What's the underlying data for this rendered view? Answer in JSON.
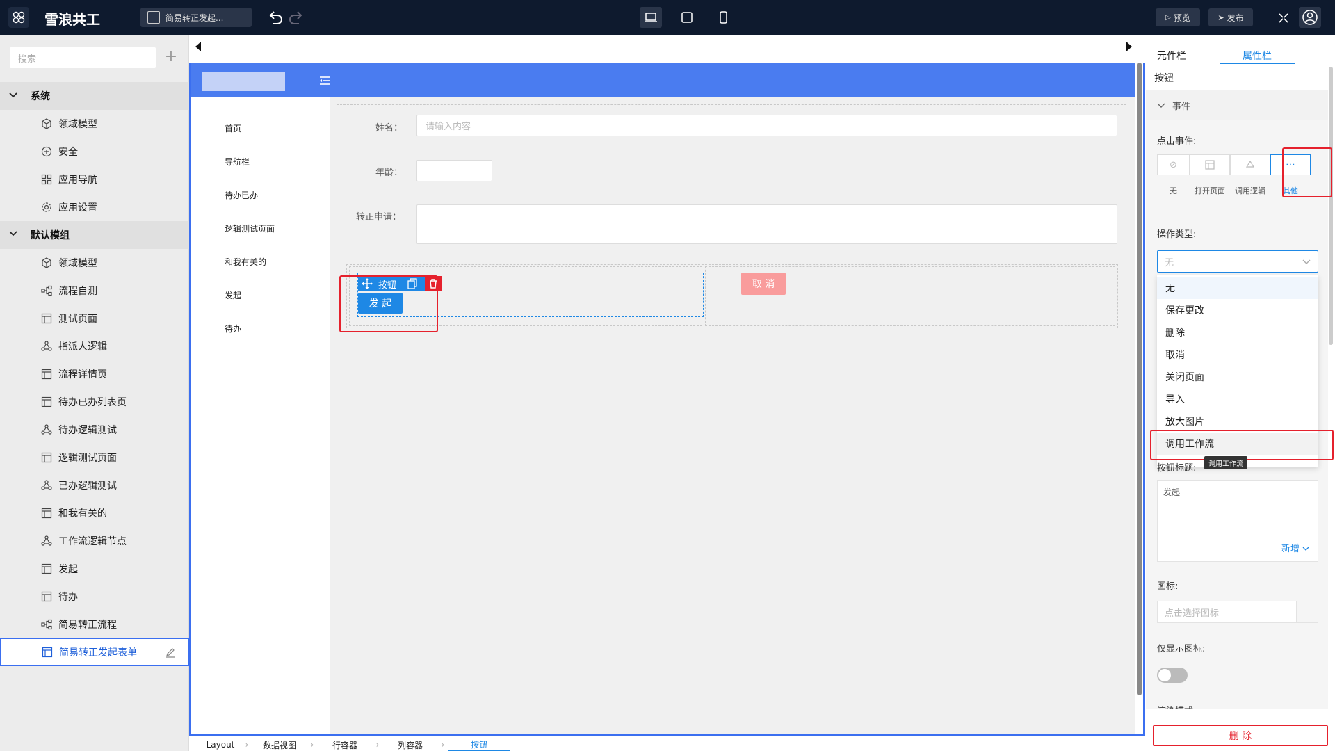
{
  "app": {
    "title": "雪浪共工"
  },
  "topbar": {
    "page_tab": "简易转正发起...",
    "preview": "预览",
    "publish": "发布"
  },
  "sidebar": {
    "search_placeholder": "搜索",
    "groups": [
      {
        "label": "系统",
        "items": [
          {
            "label": "领域模型",
            "icon": "cube-icon"
          },
          {
            "label": "安全",
            "icon": "shield-plus-icon"
          },
          {
            "label": "应用导航",
            "icon": "grid-icon"
          },
          {
            "label": "应用设置",
            "icon": "gear-icon"
          }
        ]
      },
      {
        "label": "默认模组",
        "items": [
          {
            "label": "领域模型",
            "icon": "cube-icon"
          },
          {
            "label": "流程自测",
            "icon": "flow-icon"
          },
          {
            "label": "测试页面",
            "icon": "page-icon"
          },
          {
            "label": "指派人逻辑",
            "icon": "logic-icon"
          },
          {
            "label": "流程详情页",
            "icon": "page-icon"
          },
          {
            "label": "待办已办列表页",
            "icon": "page-icon"
          },
          {
            "label": "待办逻辑测试",
            "icon": "logic-icon"
          },
          {
            "label": "逻辑测试页面",
            "icon": "page-icon"
          },
          {
            "label": "已办逻辑测试",
            "icon": "logic-icon"
          },
          {
            "label": "和我有关的",
            "icon": "page-icon"
          },
          {
            "label": "工作流逻辑节点",
            "icon": "logic-icon"
          },
          {
            "label": "发起",
            "icon": "page-icon"
          },
          {
            "label": "待办",
            "icon": "page-icon"
          },
          {
            "label": "简易转正流程",
            "icon": "flow-icon"
          },
          {
            "label": "简易转正发起表单",
            "icon": "page-icon"
          }
        ]
      }
    ]
  },
  "canvas": {
    "menu": [
      "首页",
      "导航栏",
      "待办已办",
      "逻辑测试页面",
      "和我有关的",
      "发起",
      "待办"
    ],
    "form": {
      "name_label": "姓名：",
      "name_placeholder": "请输入内容",
      "age_label": "年龄：",
      "apply_label": "转正申请：",
      "button_tag": "按钮",
      "submit_button": "发 起",
      "cancel_button": "取 消"
    }
  },
  "breadcrumb": [
    "Layout",
    "数据视图",
    "行容器",
    "列容器",
    "按钮"
  ],
  "right_panel": {
    "tabs": [
      "元件栏",
      "属性栏"
    ],
    "component_name": "按钮",
    "section_event": "事件",
    "click_event_label": "点击事件:",
    "click_options": [
      "无",
      "打开页面",
      "调用逻辑",
      "其他"
    ],
    "op_type_label": "操作类型:",
    "op_type_value": "无",
    "dropdown_options": [
      "无",
      "保存更改",
      "删除",
      "取消",
      "关闭页面",
      "导入",
      "放大图片",
      "调用工作流"
    ],
    "tooltip": "调用工作流",
    "button_title_label": "按钮标题:",
    "button_title_value": "发起",
    "add_new": "新增",
    "icon_label": "图标:",
    "icon_placeholder": "点击选择图标",
    "only_icon_label": "仅显示图标:",
    "render_mode_label": "渲染模式:",
    "delete_button": "删 除"
  },
  "colors": {
    "topbar": "#0e1a2e",
    "primary": "#1e88e5",
    "header_blue": "#4a7cf0",
    "danger": "#e5212d",
    "cancel": "#f99c9c"
  }
}
